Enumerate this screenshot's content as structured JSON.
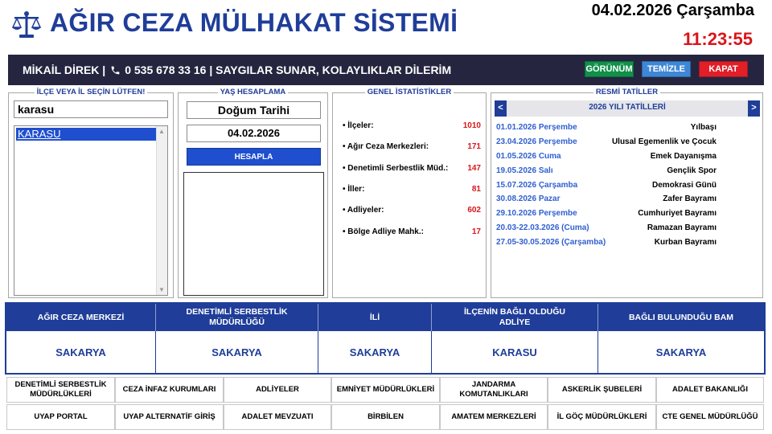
{
  "header": {
    "title": "AĞIR CEZA MÜLHAKAT SİSTEMİ",
    "date_line": "04.02.2026 Çarşamba",
    "clock": "11:23:55",
    "accent": "#1f3d99"
  },
  "topbar": {
    "name": "MİKAİL DİREK |",
    "phone": "0 535 678 33 16 | SAYGILAR SUNAR, KOLAYLIKLAR DİLERİM",
    "phone_icon": "phone-icon",
    "buttons": {
      "view": "GÖRÜNÜM",
      "clear": "TEMİZLE",
      "close": "KAPAT"
    }
  },
  "district": {
    "legend": "İLÇE VEYA İL SEÇİN LÜTFEN!",
    "search_value": "karasu",
    "list": [
      "KARASU"
    ]
  },
  "age": {
    "legend": "YAŞ HESAPLAMA",
    "dob_label": "Doğum Tarihi",
    "dob_value": "04.02.2026",
    "calc_button": "HESAPLA"
  },
  "stats": {
    "legend": "GENEL İSTATİSTİKLER",
    "rows": [
      {
        "label": "• İlçeler:",
        "value": "1010"
      },
      {
        "label": "• Ağır Ceza Merkezleri:",
        "value": "171"
      },
      {
        "label": "• Denetimli Serbestlik Müd.:",
        "value": "147"
      },
      {
        "label": "• İller:",
        "value": "81"
      },
      {
        "label": "• Adliyeler:",
        "value": "602"
      },
      {
        "label": "• Bölge Adliye Mahk.:",
        "value": "17"
      }
    ]
  },
  "holidays": {
    "legend": "RESMİ TATİLLER",
    "title": "2026 YILI TATİLLERİ",
    "prev": "<",
    "next": ">",
    "rows": [
      {
        "date": "01.01.2026 Perşembe",
        "name": "Yılbaşı"
      },
      {
        "date": "23.04.2026 Perşembe",
        "name": "Ulusal Egemenlik ve Çocuk"
      },
      {
        "date": "01.05.2026 Cuma",
        "name": "Emek Dayanışma"
      },
      {
        "date": "19.05.2026 Salı",
        "name": "Gençlik Spor"
      },
      {
        "date": "15.07.2026 Çarşamba",
        "name": "Demokrasi Günü"
      },
      {
        "date": "30.08.2026 Pazar",
        "name": "Zafer Bayramı"
      },
      {
        "date": "29.10.2026 Perşembe",
        "name": "Cumhuriyet Bayramı"
      },
      {
        "date": "20.03-22.03.2026 (Cuma)",
        "name": "Ramazan Bayramı"
      },
      {
        "date": "27.05-30.05.2026 (Çarşamba)",
        "name": "Kurban Bayramı"
      }
    ]
  },
  "info": {
    "headers": [
      "AĞIR CEZA MERKEZİ",
      "DENETİMLİ SERBESTLİK MÜDÜRLÜĞÜ",
      "İLİ",
      "İLÇENİN BAĞLI OLDUĞU ADLİYE",
      "BAĞLI BULUNDUĞU BAM"
    ],
    "values": [
      "SAKARYA",
      "SAKARYA",
      "SAKARYA",
      "KARASU",
      "SAKARYA"
    ]
  },
  "links": {
    "row1": [
      "DENETİMLİ SERBESTLİK MÜDÜRLÜKLERİ",
      "CEZA İNFAZ KURUMLARI",
      "ADLİYELER",
      "EMNİYET MÜDÜRLÜKLERİ",
      "JANDARMA KOMUTANLIKLARI",
      "ASKERLİK ŞUBELERİ",
      "ADALET BAKANLIĞI"
    ],
    "row2": [
      "UYAP PORTAL",
      "UYAP ALTERNATİF GİRİŞ",
      "ADALET MEVZUATI",
      "BİRBİLEN",
      "AMATEM MERKEZLERİ",
      "İL GÖÇ MÜDÜRLÜKLERİ",
      "CTE GENEL MÜDÜRLÜĞÜ"
    ]
  }
}
